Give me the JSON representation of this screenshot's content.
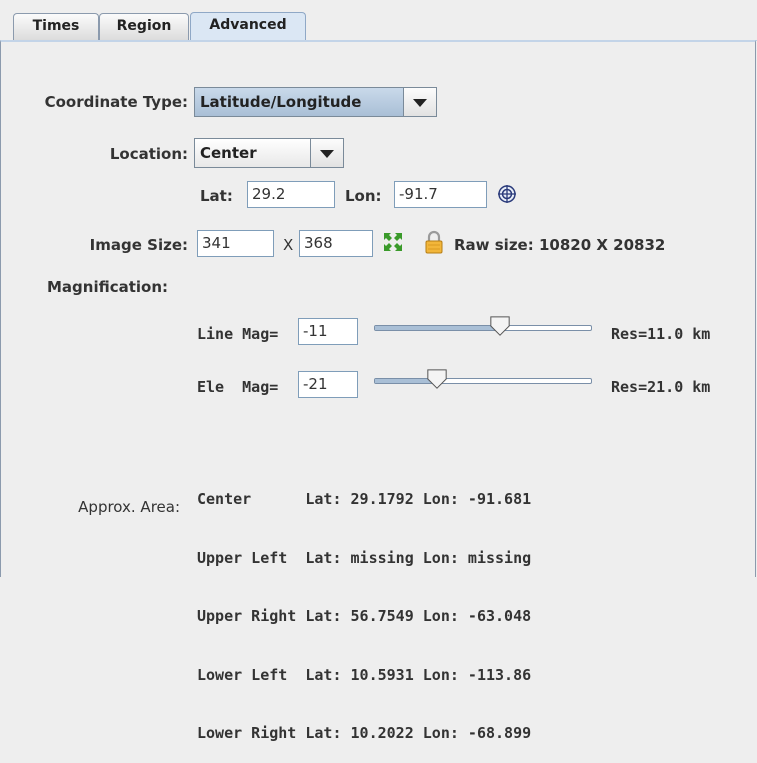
{
  "tabs": [
    {
      "label": "Times",
      "active": false
    },
    {
      "label": "Region",
      "active": false
    },
    {
      "label": "Advanced",
      "active": true
    }
  ],
  "coordinate_type": {
    "label": "Coordinate Type:",
    "value": "Latitude/Longitude"
  },
  "location": {
    "label": "Location:",
    "value": "Center"
  },
  "lat": {
    "label": "Lat:",
    "value": "29.2"
  },
  "lon": {
    "label": "Lon:",
    "value": "-91.7"
  },
  "image_size": {
    "label": "Image Size:",
    "lines": "341",
    "x_label": "X",
    "elements": "368",
    "raw_size": "Raw size: 10820 X 20832"
  },
  "magnification": {
    "label": "Magnification:"
  },
  "line_mag": {
    "label": "Line Mag=",
    "value": "-11",
    "res": "Res=11.0 km",
    "level": 0.58
  },
  "ele_mag": {
    "label": "Ele  Mag=",
    "value": "-21",
    "res": "Res=21.0 km",
    "level": 0.29
  },
  "approx_area": {
    "label": "Approx. Area:",
    "rows": [
      "Center      Lat: 29.1792 Lon: -91.681",
      "Upper Left  Lat: missing Lon: missing",
      "Upper Right Lat: 56.7549 Lon: -63.048",
      "Lower Left  Lat: 10.5931 Lon: -113.86",
      "Lower Right Lat: 10.2022 Lon: -68.899"
    ]
  },
  "colors": {
    "tab_active": "#dbe7f4",
    "combo": "#b8cce0",
    "background": "#eeeeee"
  },
  "icons": [
    "target-icon",
    "resize-icon",
    "lock-icon"
  ]
}
